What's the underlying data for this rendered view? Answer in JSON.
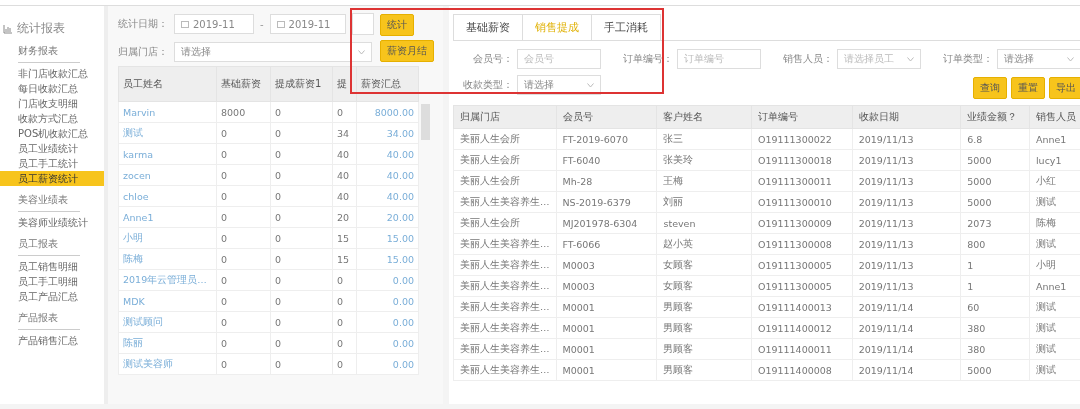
{
  "sidebar": {
    "title": "统计报表",
    "groups": [
      {
        "heading": "财务报表",
        "items": [
          {
            "label": "非门店收款汇总",
            "selected": false
          },
          {
            "label": "每日收款汇总",
            "selected": false
          },
          {
            "label": "门店收支明细",
            "selected": false
          },
          {
            "label": "收款方式汇总",
            "selected": false
          },
          {
            "label": "POS机收款汇总",
            "selected": false
          },
          {
            "label": "员工业绩统计",
            "selected": false
          },
          {
            "label": "员工手工统计",
            "selected": false
          },
          {
            "label": "员工薪资统计",
            "selected": true
          }
        ]
      },
      {
        "heading": "美容业绩表",
        "items": [
          {
            "label": "美容师业绩统计",
            "selected": false
          }
        ]
      },
      {
        "heading": "员工报表",
        "items": [
          {
            "label": "员工销售明细",
            "selected": false
          },
          {
            "label": "员工手工明细",
            "selected": false
          },
          {
            "label": "员工产品汇总",
            "selected": false
          }
        ]
      },
      {
        "heading": "产品报表",
        "items": [
          {
            "label": "产品销售汇总",
            "selected": false
          }
        ]
      }
    ]
  },
  "salary_panel": {
    "date_label": "统计日期：",
    "date_from": "2019-11",
    "date_separator": "-",
    "date_to": "2019-11",
    "store_label": "归属门店：",
    "store_value": "请选择",
    "buttons": [
      "统计",
      "薪资月结"
    ],
    "columns": [
      "员工姓名",
      "基础薪资",
      "提成薪资1",
      "提",
      "薪资汇总"
    ],
    "rows": [
      [
        "Marvin",
        "8000",
        "0",
        "0",
        "8000.00"
      ],
      [
        "测试",
        "0",
        "0",
        "34",
        "34.00"
      ],
      [
        "karma",
        "0",
        "0",
        "40",
        "40.00"
      ],
      [
        "zocen",
        "0",
        "0",
        "40",
        "40.00"
      ],
      [
        "chloe",
        "0",
        "0",
        "40",
        "40.00"
      ],
      [
        "Anne1",
        "0",
        "0",
        "20",
        "20.00"
      ],
      [
        "小明",
        "0",
        "0",
        "15",
        "15.00"
      ],
      [
        "陈梅",
        "0",
        "0",
        "15",
        "15.00"
      ],
      [
        "2019年云管理员…",
        "0",
        "0",
        "0",
        "0.00"
      ],
      [
        "MDK",
        "0",
        "0",
        "0",
        "0.00"
      ],
      [
        "测试顾问",
        "0",
        "0",
        "0",
        "0.00"
      ],
      [
        "陈丽",
        "0",
        "0",
        "0",
        "0.00"
      ],
      [
        "测试美容师",
        "0",
        "0",
        "0",
        "0.00"
      ]
    ]
  },
  "detail_panel": {
    "tabs": [
      {
        "label": "基础薪资",
        "selected": false
      },
      {
        "label": "销售提成",
        "selected": true
      },
      {
        "label": "手工消耗",
        "selected": false
      }
    ],
    "filters": [
      {
        "label": "会员号：",
        "placeholder": "会员号",
        "kind": "input"
      },
      {
        "label": "订单编号：",
        "placeholder": "订单编号",
        "kind": "input"
      },
      {
        "label": "销售人员：",
        "placeholder": "请选择员工",
        "kind": "select"
      },
      {
        "label": "订单类型：",
        "value": "请选择",
        "kind": "select"
      },
      {
        "label": "收款类型：",
        "value": "请选择",
        "kind": "select"
      }
    ],
    "buttons": [
      "查询",
      "重置",
      "导出"
    ],
    "columns": [
      "归属门店",
      "会员号",
      "客户姓名",
      "订单编号",
      "收款日期",
      "业绩金额？",
      "销售人员"
    ],
    "rows": [
      [
        "美丽人生会所",
        "FT-2019-6070",
        "张三",
        "O19111300022",
        "2019/11/13",
        "6.8",
        "Anne1"
      ],
      [
        "美丽人生会所",
        "FT-6040",
        "张美玲",
        "O19111300018",
        "2019/11/13",
        "5000",
        "lucy1"
      ],
      [
        "美丽人生会所",
        "Mh-28",
        "王梅",
        "O19111300011",
        "2019/11/13",
        "5000",
        "小红"
      ],
      [
        "美丽人生美容养生…",
        "NS-2019-6379",
        "刘丽",
        "O19111300010",
        "2019/11/13",
        "5000",
        "测试"
      ],
      [
        "美丽人生会所",
        "MJ201978-6304",
        "steven",
        "O19111300009",
        "2019/11/13",
        "2073",
        "陈梅"
      ],
      [
        "美丽人生美容养生…",
        "FT-6066",
        "赵小英",
        "O19111300008",
        "2019/11/13",
        "800",
        "测试"
      ],
      [
        "美丽人生美容养生…",
        "M0003",
        "女顾客",
        "O19111300005",
        "2019/11/13",
        "1",
        "小明"
      ],
      [
        "美丽人生美容养生…",
        "M0003",
        "女顾客",
        "O19111300005",
        "2019/11/13",
        "1",
        "Anne1"
      ],
      [
        "美丽人生美容养生…",
        "M0001",
        "男顾客",
        "O19111400013",
        "2019/11/14",
        "60",
        "测试"
      ],
      [
        "美丽人生美容养生…",
        "M0001",
        "男顾客",
        "O19111400012",
        "2019/11/14",
        "380",
        "测试"
      ],
      [
        "美丽人生美容养生…",
        "M0001",
        "男顾客",
        "O19111400011",
        "2019/11/14",
        "380",
        "测试"
      ],
      [
        "美丽人生美容养生…",
        "M0001",
        "男顾客",
        "O19111400008",
        "2019/11/14",
        "5000",
        "测试"
      ]
    ]
  }
}
